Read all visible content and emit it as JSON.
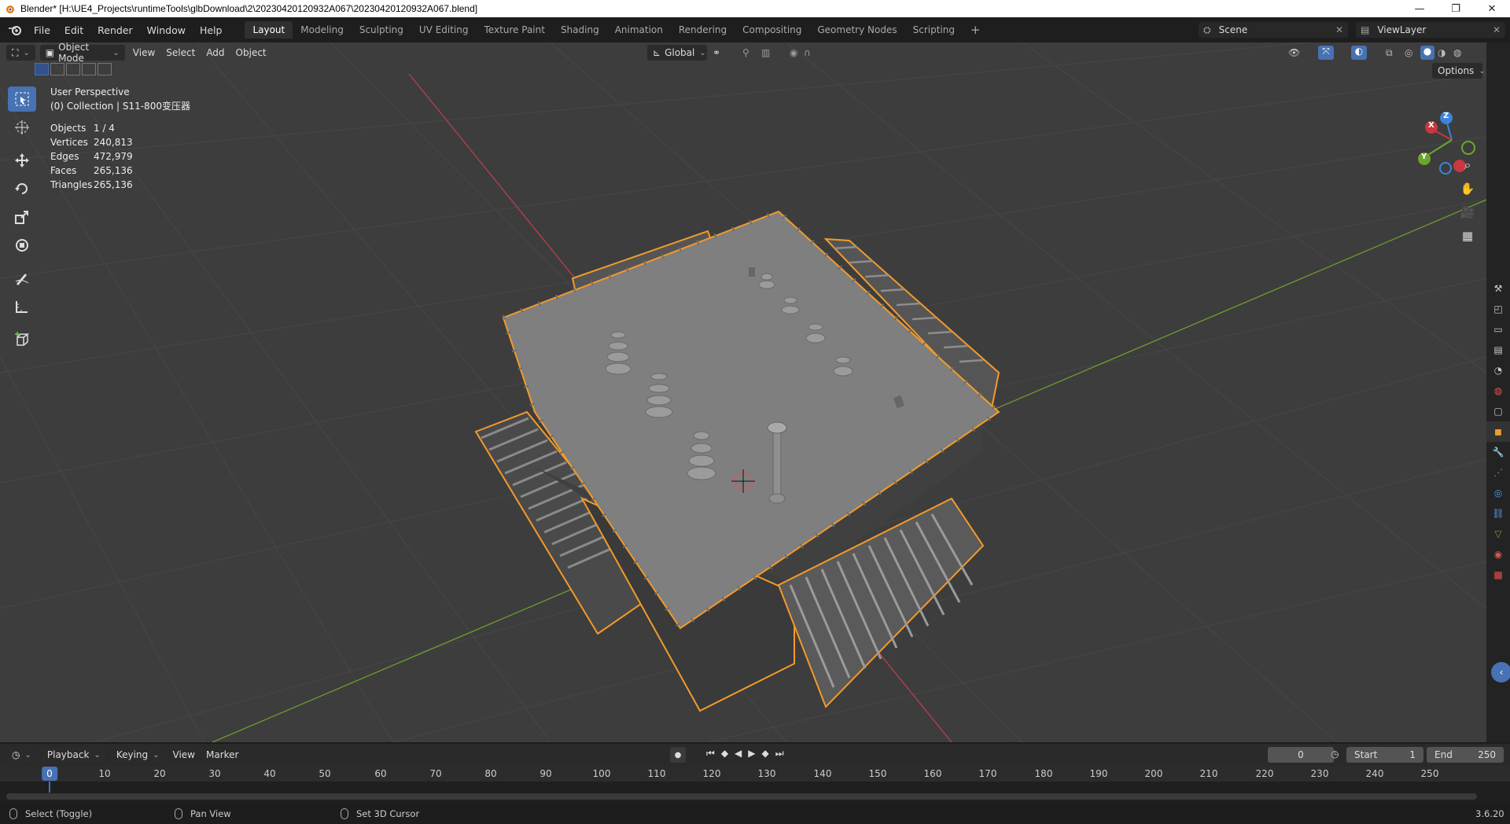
{
  "window": {
    "title": "Blender* [H:\\UE4_Projects\\runtimeTools\\glbDownload\\2\\20230420120932A067\\20230420120932A067.blend]",
    "minimize": "—",
    "maximize": "❐",
    "close": "✕"
  },
  "menu": [
    "File",
    "Edit",
    "Render",
    "Window",
    "Help"
  ],
  "workspaces": [
    "Layout",
    "Modeling",
    "Sculpting",
    "UV Editing",
    "Texture Paint",
    "Shading",
    "Animation",
    "Rendering",
    "Compositing",
    "Geometry Nodes",
    "Scripting"
  ],
  "active_workspace": "Layout",
  "add_workspace": "+",
  "scene": {
    "name": "Scene"
  },
  "view_layer": {
    "name": "ViewLayer"
  },
  "viewport_header": {
    "mode": "Object Mode",
    "menus": [
      "View",
      "Select",
      "Add",
      "Object"
    ],
    "transform_orientation": "Global",
    "options": "Options"
  },
  "overlay_text": {
    "view_name": "User Perspective",
    "collection": "(0) Collection | S11-800变压器"
  },
  "stats": [
    {
      "label": "Objects",
      "value": "1 / 4"
    },
    {
      "label": "Vertices",
      "value": "240,813"
    },
    {
      "label": "Edges",
      "value": "472,979"
    },
    {
      "label": "Faces",
      "value": "265,136"
    },
    {
      "label": "Triangles",
      "value": "265,136"
    }
  ],
  "gizmo": {
    "x": "X",
    "y": "Y",
    "z": "Z"
  },
  "timeline": {
    "menus": [
      "Playback",
      "Keying",
      "View",
      "Marker"
    ],
    "current_frame": "0",
    "start_label": "Start",
    "start": "1",
    "end_label": "End",
    "end": "250",
    "frame_marks": [
      "10",
      "20",
      "30",
      "40",
      "50",
      "60",
      "70",
      "80",
      "90",
      "100",
      "110",
      "120",
      "130",
      "140",
      "150",
      "160",
      "170",
      "180",
      "190",
      "200",
      "210",
      "220",
      "230",
      "240",
      "250"
    ],
    "cursor_frame": "0"
  },
  "statusbar": {
    "select": "Select (Toggle)",
    "pan": "Pan View",
    "cursor": "Set 3D Cursor",
    "version": "3.6.20"
  },
  "colors": {
    "accent": "#4772b3",
    "selection_outline": "#f39a2b",
    "x_axis": "#c9373f",
    "y_axis": "#6ea52c",
    "z_axis": "#3d83d8"
  }
}
